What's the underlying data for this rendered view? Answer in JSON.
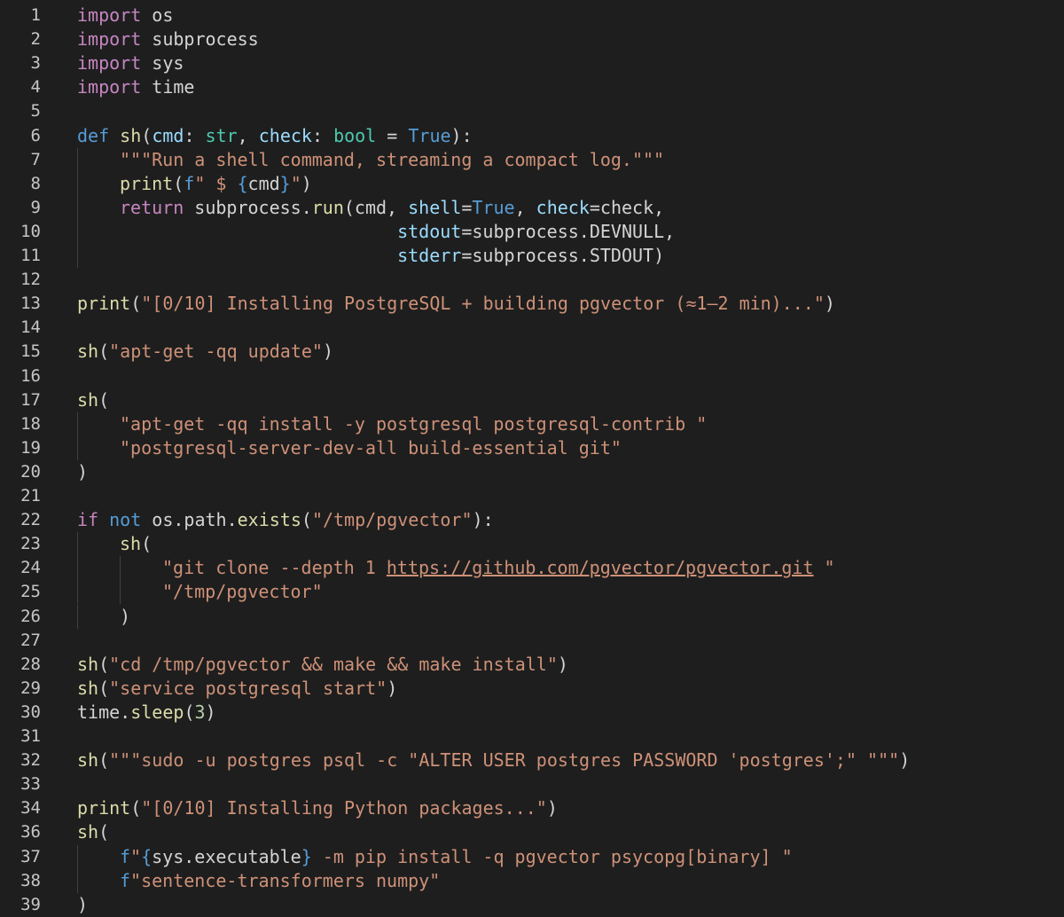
{
  "colors": {
    "background": "#1e1e1e",
    "line_number": "#c6c6c6",
    "default_text": "#d4d4d4",
    "keyword": "#c586c0",
    "builtin_keyword": "#569cd6",
    "function": "#dcdcaa",
    "string": "#ce9178",
    "number": "#b5cea8",
    "parameter": "#9cdcfe",
    "type": "#4ec9b0",
    "indent_guide": "#404040"
  },
  "lines": [
    {
      "n": "1",
      "indent": 0,
      "tokens": [
        [
          "kw",
          "import"
        ],
        [
          "pl",
          " os"
        ]
      ]
    },
    {
      "n": "2",
      "indent": 0,
      "tokens": [
        [
          "kw",
          "import"
        ],
        [
          "pl",
          " subprocess"
        ]
      ]
    },
    {
      "n": "3",
      "indent": 0,
      "tokens": [
        [
          "kw",
          "import"
        ],
        [
          "pl",
          " sys"
        ]
      ]
    },
    {
      "n": "4",
      "indent": 0,
      "tokens": [
        [
          "kw",
          "import"
        ],
        [
          "pl",
          " time"
        ]
      ]
    },
    {
      "n": "5",
      "indent": 0,
      "tokens": []
    },
    {
      "n": "6",
      "indent": 0,
      "tokens": [
        [
          "kwb",
          "def"
        ],
        [
          "pl",
          " "
        ],
        [
          "fn",
          "sh"
        ],
        [
          "pl",
          "("
        ],
        [
          "par",
          "cmd"
        ],
        [
          "pl",
          ": "
        ],
        [
          "typ",
          "str"
        ],
        [
          "pl",
          ", "
        ],
        [
          "par",
          "check"
        ],
        [
          "pl",
          ": "
        ],
        [
          "typ",
          "bool"
        ],
        [
          "pl",
          " = "
        ],
        [
          "kwb",
          "True"
        ],
        [
          "pl",
          "):"
        ]
      ]
    },
    {
      "n": "7",
      "indent": 1,
      "tokens": [
        [
          "str",
          "\"\"\"Run a shell command, streaming a compact log.\"\"\""
        ]
      ]
    },
    {
      "n": "8",
      "indent": 1,
      "tokens": [
        [
          "fn",
          "print"
        ],
        [
          "pl",
          "("
        ],
        [
          "kwb",
          "f"
        ],
        [
          "str",
          "\" $ "
        ],
        [
          "kwb",
          "{"
        ],
        [
          "pl",
          "cmd"
        ],
        [
          "kwb",
          "}"
        ],
        [
          "str",
          "\""
        ],
        [
          "pl",
          ")"
        ]
      ]
    },
    {
      "n": "9",
      "indent": 1,
      "tokens": [
        [
          "kw",
          "return"
        ],
        [
          "pl",
          " subprocess."
        ],
        [
          "fn",
          "run"
        ],
        [
          "pl",
          "(cmd, "
        ],
        [
          "par",
          "shell"
        ],
        [
          "pl",
          "="
        ],
        [
          "kwb",
          "True"
        ],
        [
          "pl",
          ", "
        ],
        [
          "par",
          "check"
        ],
        [
          "pl",
          "=check,"
        ]
      ]
    },
    {
      "n": "10",
      "indent": 1,
      "tokens": [
        [
          "pl",
          "                          "
        ],
        [
          "par",
          "stdout"
        ],
        [
          "pl",
          "=subprocess.DEVNULL,"
        ]
      ]
    },
    {
      "n": "11",
      "indent": 1,
      "tokens": [
        [
          "pl",
          "                          "
        ],
        [
          "par",
          "stderr"
        ],
        [
          "pl",
          "=subprocess.STDOUT)"
        ]
      ]
    },
    {
      "n": "12",
      "indent": 0,
      "tokens": []
    },
    {
      "n": "13",
      "indent": 0,
      "tokens": [
        [
          "fn",
          "print"
        ],
        [
          "pl",
          "("
        ],
        [
          "str",
          "\"[0/10] Installing PostgreSQL + building pgvector (≈1–2 min)...\""
        ],
        [
          "pl",
          ")"
        ]
      ]
    },
    {
      "n": "14",
      "indent": 0,
      "tokens": []
    },
    {
      "n": "15",
      "indent": 0,
      "tokens": [
        [
          "fn",
          "sh"
        ],
        [
          "pl",
          "("
        ],
        [
          "str",
          "\"apt-get -qq update\""
        ],
        [
          "pl",
          ")"
        ]
      ]
    },
    {
      "n": "16",
      "indent": 0,
      "tokens": []
    },
    {
      "n": "17",
      "indent": 0,
      "tokens": [
        [
          "fn",
          "sh"
        ],
        [
          "pl",
          "("
        ]
      ]
    },
    {
      "n": "18",
      "indent": 1,
      "tokens": [
        [
          "str",
          "\"apt-get -qq install -y postgresql postgresql-contrib \""
        ]
      ]
    },
    {
      "n": "19",
      "indent": 1,
      "tokens": [
        [
          "str",
          "\"postgresql-server-dev-all build-essential git\""
        ]
      ]
    },
    {
      "n": "20",
      "indent": 0,
      "tokens": [
        [
          "pl",
          ")"
        ]
      ]
    },
    {
      "n": "21",
      "indent": 0,
      "tokens": []
    },
    {
      "n": "22",
      "indent": 0,
      "tokens": [
        [
          "kw",
          "if"
        ],
        [
          "pl",
          " "
        ],
        [
          "kwb",
          "not"
        ],
        [
          "pl",
          " os.path."
        ],
        [
          "fn",
          "exists"
        ],
        [
          "pl",
          "("
        ],
        [
          "str",
          "\"/tmp/pgvector\""
        ],
        [
          "pl",
          "):"
        ]
      ]
    },
    {
      "n": "23",
      "indent": 1,
      "tokens": [
        [
          "fn",
          "sh"
        ],
        [
          "pl",
          "("
        ]
      ]
    },
    {
      "n": "24",
      "indent": 2,
      "tokens": [
        [
          "str",
          "\"git clone --depth 1 "
        ],
        [
          "str lnk",
          "https://github.com/pgvector/pgvector.git"
        ],
        [
          "str",
          " \""
        ]
      ]
    },
    {
      "n": "25",
      "indent": 2,
      "tokens": [
        [
          "str",
          "\"/tmp/pgvector\""
        ]
      ]
    },
    {
      "n": "26",
      "indent": 1,
      "tokens": [
        [
          "pl",
          ")"
        ]
      ]
    },
    {
      "n": "27",
      "indent": 0,
      "tokens": []
    },
    {
      "n": "28",
      "indent": 0,
      "tokens": [
        [
          "fn",
          "sh"
        ],
        [
          "pl",
          "("
        ],
        [
          "str",
          "\"cd /tmp/pgvector && make && make install\""
        ],
        [
          "pl",
          ")"
        ]
      ]
    },
    {
      "n": "29",
      "indent": 0,
      "tokens": [
        [
          "fn",
          "sh"
        ],
        [
          "pl",
          "("
        ],
        [
          "str",
          "\"service postgresql start\""
        ],
        [
          "pl",
          ")"
        ]
      ]
    },
    {
      "n": "30",
      "indent": 0,
      "tokens": [
        [
          "pl",
          "time."
        ],
        [
          "fn",
          "sleep"
        ],
        [
          "pl",
          "("
        ],
        [
          "num",
          "3"
        ],
        [
          "pl",
          ")"
        ]
      ]
    },
    {
      "n": "31",
      "indent": 0,
      "tokens": []
    },
    {
      "n": "32",
      "indent": 0,
      "tokens": [
        [
          "fn",
          "sh"
        ],
        [
          "pl",
          "("
        ],
        [
          "str",
          "\"\"\"sudo -u postgres psql -c \"ALTER USER postgres PASSWORD 'postgres';\" \"\"\""
        ],
        [
          "pl",
          ")"
        ]
      ]
    },
    {
      "n": "33",
      "indent": 0,
      "tokens": []
    },
    {
      "n": "34",
      "indent": 0,
      "tokens": [
        [
          "fn",
          "print"
        ],
        [
          "pl",
          "("
        ],
        [
          "str",
          "\"[0/10] Installing Python packages...\""
        ],
        [
          "pl",
          ")"
        ]
      ]
    },
    {
      "n": "36",
      "indent": 0,
      "tokens": [
        [
          "fn",
          "sh"
        ],
        [
          "pl",
          "("
        ]
      ]
    },
    {
      "n": "37",
      "indent": 1,
      "tokens": [
        [
          "kwb",
          "f"
        ],
        [
          "str",
          "\""
        ],
        [
          "kwb",
          "{"
        ],
        [
          "pl",
          "sys.executable"
        ],
        [
          "kwb",
          "}"
        ],
        [
          "str",
          " -m pip install -q pgvector psycopg[binary] \""
        ]
      ]
    },
    {
      "n": "38",
      "indent": 1,
      "tokens": [
        [
          "kwb",
          "f"
        ],
        [
          "str",
          "\"sentence-transformers numpy\""
        ]
      ]
    },
    {
      "n": "39",
      "indent": 0,
      "tokens": [
        [
          "pl",
          ")"
        ]
      ]
    }
  ]
}
